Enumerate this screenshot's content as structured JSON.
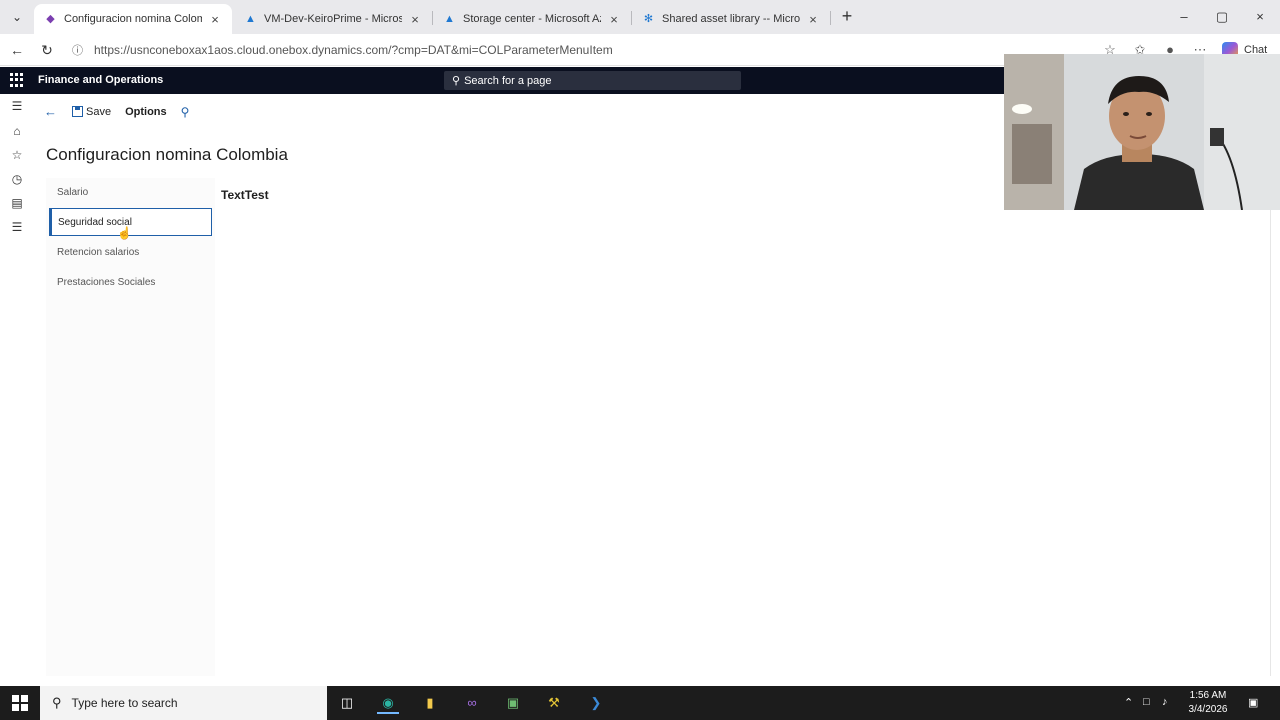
{
  "browser": {
    "tabs": [
      {
        "title": "Configuracion nomina Colombia -",
        "favicon": "dynamics-icon",
        "active": true
      },
      {
        "title": "VM-Dev-KeiroPrime - Microsoft A",
        "favicon": "azure-icon",
        "active": false
      },
      {
        "title": "Storage center - Microsoft Azure",
        "favicon": "azure-icon",
        "active": false
      },
      {
        "title": "Shared asset library -- Microsoft D",
        "favicon": "lcs-icon",
        "active": false
      }
    ],
    "url": "https://usnconeboxax1aos.cloud.onebox.dynamics.com/?cmp=DAT&mi=COLParameterMenuItem",
    "chat_label": "Chat"
  },
  "app": {
    "name": "Finance and Operations",
    "search_placeholder": "Search for a page"
  },
  "actionpane": {
    "save_label": "Save",
    "options_label": "Options"
  },
  "page": {
    "title": "Configuracion nomina Colombia",
    "vtabs": [
      {
        "label": "Salario",
        "selected": false
      },
      {
        "label": "Seguridad social",
        "selected": true
      },
      {
        "label": "Retencion salarios",
        "selected": false
      },
      {
        "label": "Prestaciones Sociales",
        "selected": false
      }
    ],
    "content_text": "TextTest"
  },
  "taskbar": {
    "search_placeholder": "Type here to search",
    "time": "1:56 AM",
    "date": "3/4/2026"
  },
  "colors": {
    "accent": "#1f5fa8",
    "d365_bar": "#0a0f1f"
  }
}
